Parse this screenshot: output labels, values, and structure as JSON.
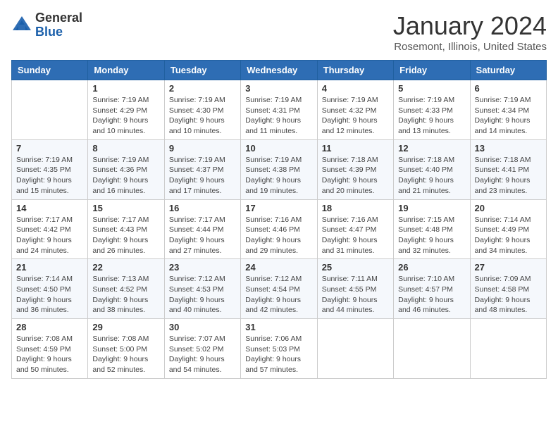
{
  "app": {
    "logo_line1": "General",
    "logo_line2": "Blue"
  },
  "header": {
    "title": "January 2024",
    "location": "Rosemont, Illinois, United States"
  },
  "weekdays": [
    "Sunday",
    "Monday",
    "Tuesday",
    "Wednesday",
    "Thursday",
    "Friday",
    "Saturday"
  ],
  "weeks": [
    [
      {
        "day": "",
        "sunrise": "",
        "sunset": "",
        "daylight": ""
      },
      {
        "day": "1",
        "sunrise": "Sunrise: 7:19 AM",
        "sunset": "Sunset: 4:29 PM",
        "daylight": "Daylight: 9 hours and 10 minutes."
      },
      {
        "day": "2",
        "sunrise": "Sunrise: 7:19 AM",
        "sunset": "Sunset: 4:30 PM",
        "daylight": "Daylight: 9 hours and 10 minutes."
      },
      {
        "day": "3",
        "sunrise": "Sunrise: 7:19 AM",
        "sunset": "Sunset: 4:31 PM",
        "daylight": "Daylight: 9 hours and 11 minutes."
      },
      {
        "day": "4",
        "sunrise": "Sunrise: 7:19 AM",
        "sunset": "Sunset: 4:32 PM",
        "daylight": "Daylight: 9 hours and 12 minutes."
      },
      {
        "day": "5",
        "sunrise": "Sunrise: 7:19 AM",
        "sunset": "Sunset: 4:33 PM",
        "daylight": "Daylight: 9 hours and 13 minutes."
      },
      {
        "day": "6",
        "sunrise": "Sunrise: 7:19 AM",
        "sunset": "Sunset: 4:34 PM",
        "daylight": "Daylight: 9 hours and 14 minutes."
      }
    ],
    [
      {
        "day": "7",
        "sunrise": "Sunrise: 7:19 AM",
        "sunset": "Sunset: 4:35 PM",
        "daylight": "Daylight: 9 hours and 15 minutes."
      },
      {
        "day": "8",
        "sunrise": "Sunrise: 7:19 AM",
        "sunset": "Sunset: 4:36 PM",
        "daylight": "Daylight: 9 hours and 16 minutes."
      },
      {
        "day": "9",
        "sunrise": "Sunrise: 7:19 AM",
        "sunset": "Sunset: 4:37 PM",
        "daylight": "Daylight: 9 hours and 17 minutes."
      },
      {
        "day": "10",
        "sunrise": "Sunrise: 7:19 AM",
        "sunset": "Sunset: 4:38 PM",
        "daylight": "Daylight: 9 hours and 19 minutes."
      },
      {
        "day": "11",
        "sunrise": "Sunrise: 7:18 AM",
        "sunset": "Sunset: 4:39 PM",
        "daylight": "Daylight: 9 hours and 20 minutes."
      },
      {
        "day": "12",
        "sunrise": "Sunrise: 7:18 AM",
        "sunset": "Sunset: 4:40 PM",
        "daylight": "Daylight: 9 hours and 21 minutes."
      },
      {
        "day": "13",
        "sunrise": "Sunrise: 7:18 AM",
        "sunset": "Sunset: 4:41 PM",
        "daylight": "Daylight: 9 hours and 23 minutes."
      }
    ],
    [
      {
        "day": "14",
        "sunrise": "Sunrise: 7:17 AM",
        "sunset": "Sunset: 4:42 PM",
        "daylight": "Daylight: 9 hours and 24 minutes."
      },
      {
        "day": "15",
        "sunrise": "Sunrise: 7:17 AM",
        "sunset": "Sunset: 4:43 PM",
        "daylight": "Daylight: 9 hours and 26 minutes."
      },
      {
        "day": "16",
        "sunrise": "Sunrise: 7:17 AM",
        "sunset": "Sunset: 4:44 PM",
        "daylight": "Daylight: 9 hours and 27 minutes."
      },
      {
        "day": "17",
        "sunrise": "Sunrise: 7:16 AM",
        "sunset": "Sunset: 4:46 PM",
        "daylight": "Daylight: 9 hours and 29 minutes."
      },
      {
        "day": "18",
        "sunrise": "Sunrise: 7:16 AM",
        "sunset": "Sunset: 4:47 PM",
        "daylight": "Daylight: 9 hours and 31 minutes."
      },
      {
        "day": "19",
        "sunrise": "Sunrise: 7:15 AM",
        "sunset": "Sunset: 4:48 PM",
        "daylight": "Daylight: 9 hours and 32 minutes."
      },
      {
        "day": "20",
        "sunrise": "Sunrise: 7:14 AM",
        "sunset": "Sunset: 4:49 PM",
        "daylight": "Daylight: 9 hours and 34 minutes."
      }
    ],
    [
      {
        "day": "21",
        "sunrise": "Sunrise: 7:14 AM",
        "sunset": "Sunset: 4:50 PM",
        "daylight": "Daylight: 9 hours and 36 minutes."
      },
      {
        "day": "22",
        "sunrise": "Sunrise: 7:13 AM",
        "sunset": "Sunset: 4:52 PM",
        "daylight": "Daylight: 9 hours and 38 minutes."
      },
      {
        "day": "23",
        "sunrise": "Sunrise: 7:12 AM",
        "sunset": "Sunset: 4:53 PM",
        "daylight": "Daylight: 9 hours and 40 minutes."
      },
      {
        "day": "24",
        "sunrise": "Sunrise: 7:12 AM",
        "sunset": "Sunset: 4:54 PM",
        "daylight": "Daylight: 9 hours and 42 minutes."
      },
      {
        "day": "25",
        "sunrise": "Sunrise: 7:11 AM",
        "sunset": "Sunset: 4:55 PM",
        "daylight": "Daylight: 9 hours and 44 minutes."
      },
      {
        "day": "26",
        "sunrise": "Sunrise: 7:10 AM",
        "sunset": "Sunset: 4:57 PM",
        "daylight": "Daylight: 9 hours and 46 minutes."
      },
      {
        "day": "27",
        "sunrise": "Sunrise: 7:09 AM",
        "sunset": "Sunset: 4:58 PM",
        "daylight": "Daylight: 9 hours and 48 minutes."
      }
    ],
    [
      {
        "day": "28",
        "sunrise": "Sunrise: 7:08 AM",
        "sunset": "Sunset: 4:59 PM",
        "daylight": "Daylight: 9 hours and 50 minutes."
      },
      {
        "day": "29",
        "sunrise": "Sunrise: 7:08 AM",
        "sunset": "Sunset: 5:00 PM",
        "daylight": "Daylight: 9 hours and 52 minutes."
      },
      {
        "day": "30",
        "sunrise": "Sunrise: 7:07 AM",
        "sunset": "Sunset: 5:02 PM",
        "daylight": "Daylight: 9 hours and 54 minutes."
      },
      {
        "day": "31",
        "sunrise": "Sunrise: 7:06 AM",
        "sunset": "Sunset: 5:03 PM",
        "daylight": "Daylight: 9 hours and 57 minutes."
      },
      {
        "day": "",
        "sunrise": "",
        "sunset": "",
        "daylight": ""
      },
      {
        "day": "",
        "sunrise": "",
        "sunset": "",
        "daylight": ""
      },
      {
        "day": "",
        "sunrise": "",
        "sunset": "",
        "daylight": ""
      }
    ]
  ]
}
